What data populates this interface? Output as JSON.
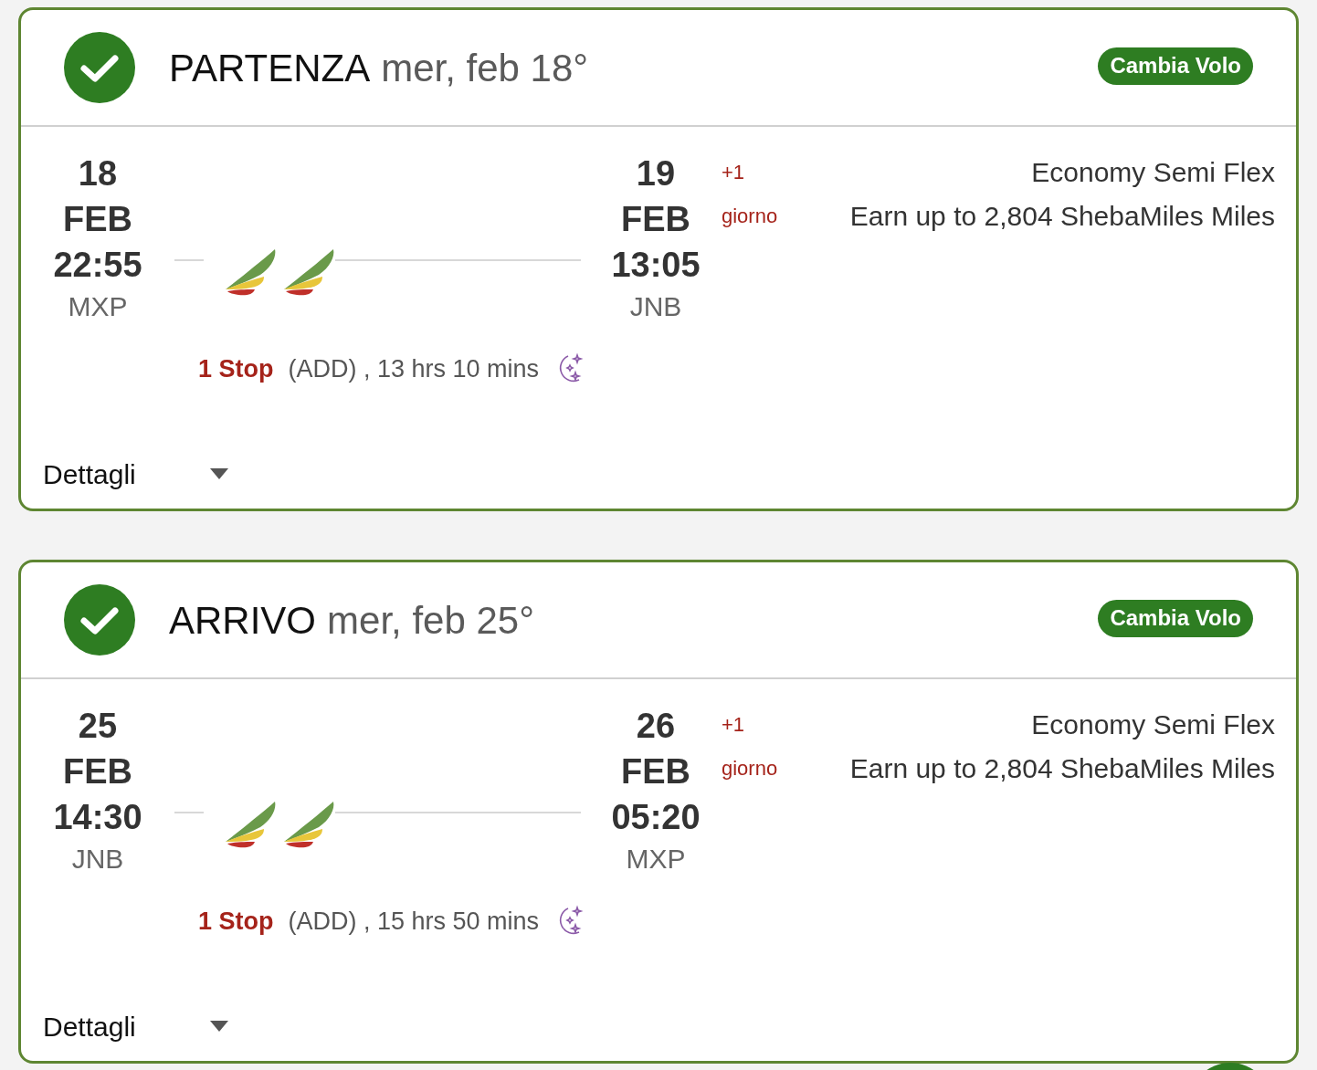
{
  "flights": [
    {
      "direction": "PARTENZA",
      "date": "mer, feb 18°",
      "change_button": "Cambia Volo",
      "departure": {
        "day": "18",
        "month": "FEB",
        "time": "22:55",
        "airport": "MXP"
      },
      "arrival": {
        "day": "19",
        "month": "FEB",
        "time": "13:05",
        "airport": "JNB"
      },
      "day_offset": "+1",
      "day_offset_unit": "giorno",
      "fare": "Economy Semi Flex",
      "miles": "Earn up to 2,804 ShebaMiles Miles",
      "stops": "1 Stop",
      "via": "(ADD) , 13 hrs 10 mins",
      "details": "Dettagli",
      "expanded": false
    },
    {
      "direction": "ARRIVO",
      "date": "mer, feb 25°",
      "change_button": "Cambia Volo",
      "departure": {
        "day": "25",
        "month": "FEB",
        "time": "14:30",
        "airport": "JNB"
      },
      "arrival": {
        "day": "26",
        "month": "FEB",
        "time": "05:20",
        "airport": "MXP"
      },
      "day_offset": "+1",
      "day_offset_unit": "giorno",
      "fare": "Economy Semi Flex",
      "miles": "Earn up to 2,804 ShebaMiles Miles",
      "stops": "1 Stop",
      "via": "(ADD) , 15 hrs 50 mins",
      "details": "Dettagli",
      "expanded": false
    }
  ]
}
